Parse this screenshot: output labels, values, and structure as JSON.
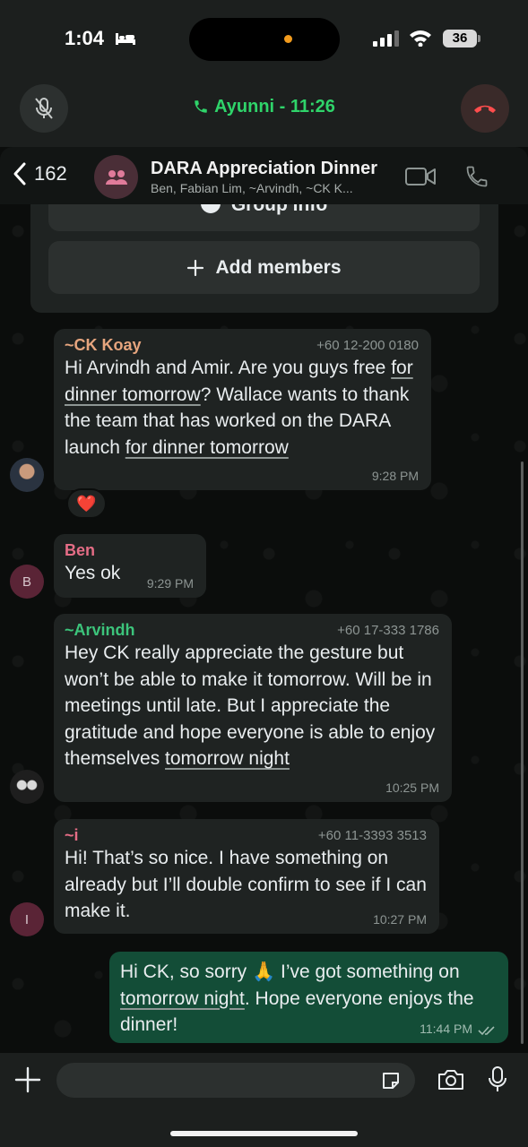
{
  "status_bar": {
    "time": "1:04",
    "battery": "36"
  },
  "call_bar": {
    "label": "Ayunni - 11:26"
  },
  "header": {
    "back_count": "162",
    "group_name": "DARA Appreciation Dinner",
    "members": "Ben, Fabian Lim, ~Arvindh, ~CK K..."
  },
  "group_card": {
    "group_info_label": "Group info",
    "add_members_label": "Add members"
  },
  "messages": [
    {
      "sender": "~CK Koay",
      "sender_color": "#e6a57e",
      "phone": "+60 12-200 0180",
      "parts": [
        "Hi Arvindh and Amir. Are you guys free ",
        "for dinner tomorrow",
        "? Wallace wants to thank the team that has worked on the DARA launch ",
        "for dinner tomorrow"
      ],
      "time": "9:28 PM",
      "reaction": "❤️"
    },
    {
      "sender": "Ben",
      "sender_color": "#e56d86",
      "avatar_initial": "B",
      "text": "Yes ok",
      "time": "9:29 PM"
    },
    {
      "sender": "~Arvindh",
      "sender_color": "#3cc47b",
      "phone": "+60 17-333 1786",
      "parts": [
        "Hey CK really appreciate the gesture but won’t be able to make it tomorrow. Will be in meetings until late. But I appreciate the gratitude and hope everyone is able to enjoy themselves ",
        "tomorrow night"
      ],
      "time": "10:25 PM"
    },
    {
      "sender": "~i",
      "sender_color": "#e56d86",
      "phone": "+60 11-3393 3513",
      "avatar_initial": "I",
      "text": "Hi! That’s so nice. I have something on already but I’ll double confirm to see if I can make it.",
      "time": "10:27 PM"
    },
    {
      "outgoing": true,
      "parts": [
        "Hi CK, so sorry 🙏 I’ve got something on ",
        "tomorrow night",
        ". Hope everyone enjoys the dinner!"
      ],
      "time": "11:44 PM"
    }
  ],
  "input": {
    "placeholder": ""
  },
  "colors": {
    "outgoing_bubble": "#134d37",
    "incoming_bubble": "#1f2322",
    "call_green": "#2fd46a"
  }
}
